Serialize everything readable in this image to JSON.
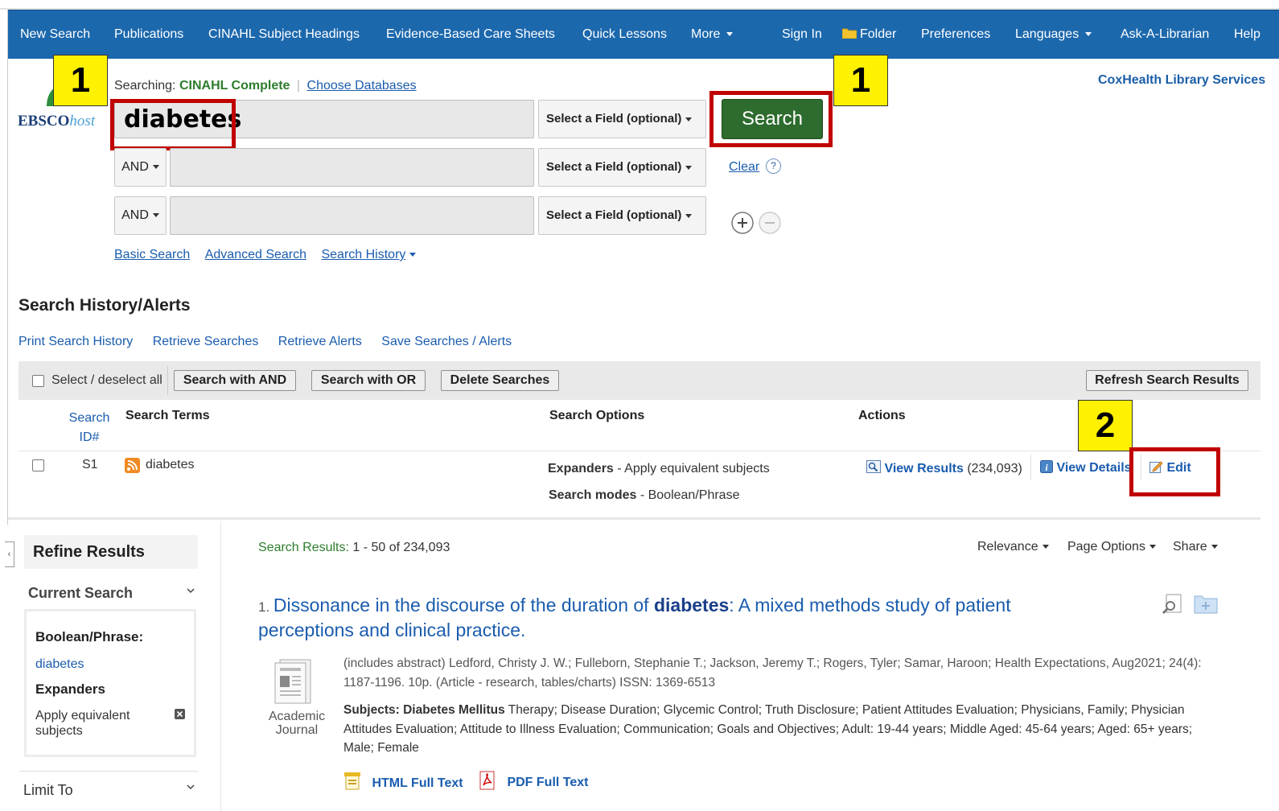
{
  "nav": {
    "items": [
      "New Search",
      "Publications",
      "CINAHL Subject Headings",
      "Evidence-Based Care Sheets",
      "Quick Lessons",
      "More",
      "Sign In",
      "Folder",
      "Preferences",
      "Languages",
      "Ask-A-Librarian",
      "Help"
    ]
  },
  "logo": {
    "text_bold": "EBSCO",
    "text_italic": "host"
  },
  "badges": {
    "one": "1",
    "two": "2"
  },
  "searching": {
    "label": "Searching:",
    "db": "CINAHL Complete",
    "choose": "Choose Databases"
  },
  "institution": "CoxHealth Library Services",
  "search": {
    "term1": "diabetes",
    "field_placeholder": "Select a Field (optional)",
    "bool1": "AND",
    "bool2": "AND",
    "button": "Search",
    "clear": "Clear",
    "help": "?"
  },
  "search_links": {
    "basic": "Basic Search",
    "advanced": "Advanced Search",
    "history": "Search History"
  },
  "history": {
    "title": "Search History/Alerts",
    "links": [
      "Print Search History",
      "Retrieve Searches",
      "Retrieve Alerts",
      "Save Searches / Alerts"
    ],
    "select_all": "Select / deselect all",
    "btn_and": "Search with AND",
    "btn_or": "Search with OR",
    "btn_delete": "Delete Searches",
    "btn_refresh": "Refresh Search Results",
    "col_id_1": "Search",
    "col_id_2": "ID#",
    "col_terms": "Search Terms",
    "col_options": "Search Options",
    "col_actions": "Actions",
    "row": {
      "id": "S1",
      "term": "diabetes",
      "exp_label": "Expanders",
      "exp_value": " - Apply equivalent subjects",
      "mode_label": "Search modes",
      "mode_value": " - Boolean/Phrase",
      "view_results": "View Results",
      "count": " (234,093)",
      "view_details": "View Details",
      "edit": "Edit"
    }
  },
  "refine": {
    "title": "Refine Results",
    "current": "Current Search",
    "bool_label": "Boolean/Phrase:",
    "bool_value": "diabetes",
    "expanders": "Expanders",
    "apply1": "Apply equivalent",
    "apply2": "subjects",
    "limit": "Limit To"
  },
  "results": {
    "summary_label": "Search Results: ",
    "summary_value": "1 - 50 of 234,093",
    "relevance": "Relevance",
    "page_options": "Page Options",
    "share": "Share",
    "r1": {
      "num": "1. ",
      "title_a": "Dissonance in the discourse of the duration of ",
      "title_b": "diabetes",
      "title_c": ": A mixed methods study of patient",
      "title_d": "perceptions and clinical practice.",
      "meta1": "(includes abstract) Ledford, Christy J. W.; Fulleborn, Stephanie T.; Jackson, Jeremy T.; Rogers, Tyler; Samar, Haroon; Health Expectations, Aug2021; 24(4):",
      "meta2": "1187-1196. 10p. (Article - research, tables/charts) ISSN: 1369-6513",
      "subj_label": "Subjects: ",
      "subj_bold": "Diabetes Mellitus",
      "subj_1": " Therapy; Disease Duration; Glycemic Control; Truth Disclosure; Patient Attitudes Evaluation; Physicians, Family; Physician",
      "subj_2": "Attitudes Evaluation; Attitude to Illness Evaluation; Communication; Goals and Objectives; Adult: 19-44 years; Middle Aged: 45-64 years; Aged: 65+ years;",
      "subj_3": "Male; Female",
      "type1": "Academic",
      "type2": "Journal",
      "html": "HTML Full Text",
      "pdf": "PDF Full Text"
    }
  },
  "colors": {
    "nav": "#1c68ad",
    "search_btn": "#2e6b2e",
    "badge": "#fff200",
    "highlight": "#c00000",
    "link": "#1a5cae",
    "db_green": "#2d7d2d"
  },
  "icons": [
    "folder-icon",
    "ebsco-logo-icon",
    "plus-circle-icon",
    "minus-circle-icon",
    "rss-icon",
    "view-results-icon",
    "info-icon",
    "edit-icon",
    "collapse-chevron-icon",
    "remove-icon",
    "journal-icon",
    "preview-icon",
    "add-folder-icon",
    "html-icon",
    "pdf-icon"
  ]
}
